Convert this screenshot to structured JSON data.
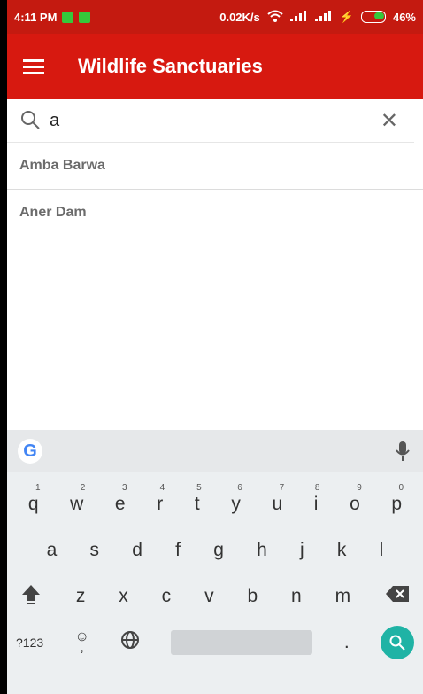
{
  "statusbar": {
    "time": "4:11 PM",
    "net_speed": "0.02K/s",
    "battery": "46%"
  },
  "appbar": {
    "title": "Wildlife Sanctuaries"
  },
  "search": {
    "value": "a"
  },
  "results": [
    {
      "name": "Amba Barwa"
    },
    {
      "name": "Aner Dam"
    }
  ],
  "keyboard": {
    "row1": [
      {
        "k": "q",
        "n": "1"
      },
      {
        "k": "w",
        "n": "2"
      },
      {
        "k": "e",
        "n": "3"
      },
      {
        "k": "r",
        "n": "4"
      },
      {
        "k": "t",
        "n": "5"
      },
      {
        "k": "y",
        "n": "6"
      },
      {
        "k": "u",
        "n": "7"
      },
      {
        "k": "i",
        "n": "8"
      },
      {
        "k": "o",
        "n": "9"
      },
      {
        "k": "p",
        "n": "0"
      }
    ],
    "row2": [
      "a",
      "s",
      "d",
      "f",
      "g",
      "h",
      "j",
      "k",
      "l"
    ],
    "row3": [
      "z",
      "x",
      "c",
      "v",
      "b",
      "n",
      "m"
    ],
    "symbols_label": "?123",
    "comma": ",",
    "period": "."
  }
}
